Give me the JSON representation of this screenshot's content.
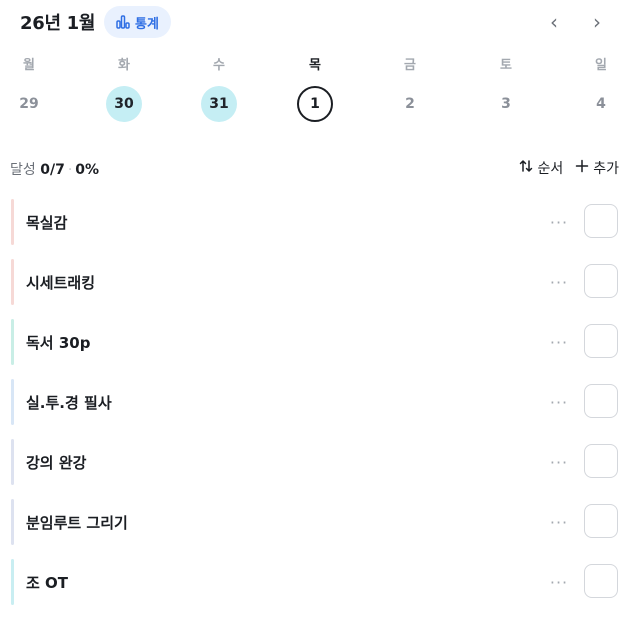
{
  "header": {
    "month": "26년 1월",
    "stats_label": "통계",
    "prev": "‹",
    "next": "›"
  },
  "weekdays": [
    "월",
    "화",
    "수",
    "목",
    "금",
    "토",
    "일"
  ],
  "dates": [
    {
      "day": "29",
      "state": "past"
    },
    {
      "day": "30",
      "state": "done"
    },
    {
      "day": "31",
      "state": "done"
    },
    {
      "day": "1",
      "state": "today"
    },
    {
      "day": "2",
      "state": "future"
    },
    {
      "day": "3",
      "state": "future"
    },
    {
      "day": "4",
      "state": "future"
    }
  ],
  "summary": {
    "label": "달성",
    "count": "0/7",
    "sep": "·",
    "percent": "0%"
  },
  "actions": {
    "sort_label": "순서",
    "add_label": "추가"
  },
  "tasks": [
    {
      "name": "목실감",
      "color": "#f6d9d6"
    },
    {
      "name": "시세트래킹",
      "color": "#f6d9d6"
    },
    {
      "name": "독서 30p",
      "color": "#c9eee6"
    },
    {
      "name": "실.투.경 필사",
      "color": "#d8e6f6"
    },
    {
      "name": "강의 완강",
      "color": "#dde2f0"
    },
    {
      "name": "분임루트 그리기",
      "color": "#dde2f0"
    },
    {
      "name": "조 OT",
      "color": "#c9eef2"
    }
  ],
  "more_label": "···",
  "colors": {
    "accent": "#2f6fe4",
    "done_day": "#c5eef4"
  }
}
